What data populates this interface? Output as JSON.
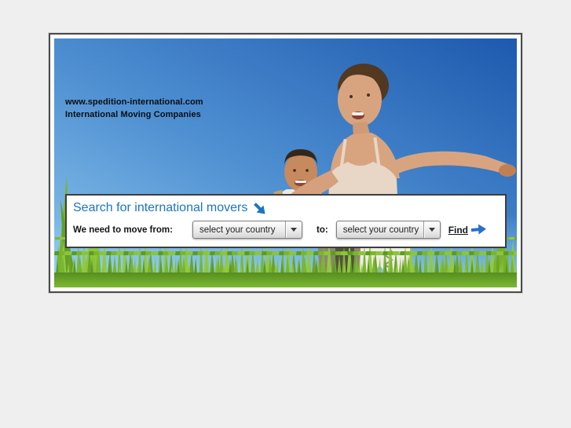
{
  "window": {
    "background_color": "#efefef",
    "frame_border_color": "#4a4a4a"
  },
  "hero": {
    "description": "Young couple jumping for joy in a green meadow under a blue summer sky",
    "sky_colors": [
      "#8cc6ec",
      "#4f90d2",
      "#1d59ae"
    ],
    "grass_colors": [
      "#92ca3e",
      "#7cb631",
      "#568f20"
    ]
  },
  "branding": {
    "url_line": "www.spedition-international.com",
    "tagline": "International Moving Companies"
  },
  "search": {
    "title": "Search for international movers",
    "title_icon": "southeast-arrow-icon",
    "accent_color": "#1b76c0",
    "from_label": "We need to move from:",
    "to_label": "to:",
    "from_select": {
      "value": "select your country",
      "icon": "chevron-down-icon"
    },
    "to_select": {
      "value": "select your country",
      "icon": "chevron-down-icon"
    },
    "find": {
      "label": "Find",
      "icon": "right-arrow-icon",
      "arrow_color": "#2a6fc8"
    }
  }
}
